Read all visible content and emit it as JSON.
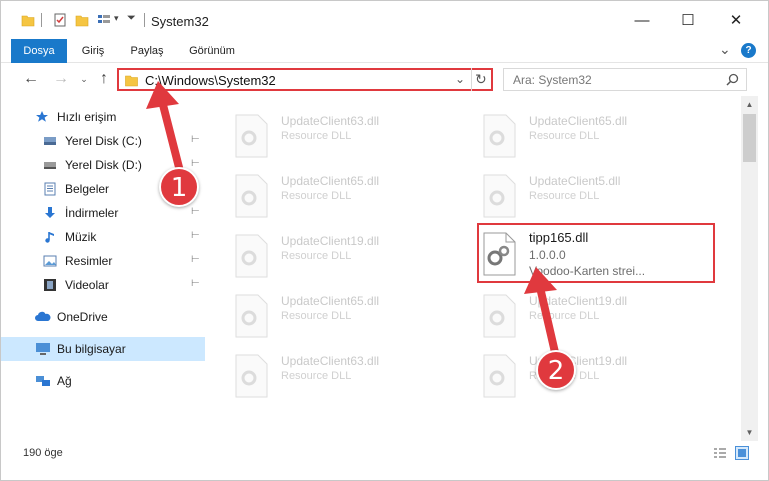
{
  "window": {
    "title": "System32",
    "minimize_glyph": "—",
    "maximize_glyph": "☐",
    "close_glyph": "✕"
  },
  "ribbon": {
    "tabs": [
      {
        "label": "Dosya",
        "active": true
      },
      {
        "label": "Giriş"
      },
      {
        "label": "Paylaş"
      },
      {
        "label": "Görünüm"
      }
    ],
    "collapse_glyph": "⌄",
    "help_glyph": "?"
  },
  "navbar": {
    "address": "C:\\Windows\\System32",
    "search_placeholder": "Ara: System32"
  },
  "sidebar": {
    "items": [
      {
        "label": "Hızlı erişim",
        "icon": "star-icon"
      },
      {
        "label": "Yerel Disk (C:)",
        "icon": "drive-icon",
        "pinned": true
      },
      {
        "label": "Yerel Disk (D:)",
        "icon": "drive-icon",
        "pinned": true
      },
      {
        "label": "Belgeler",
        "icon": "documents-icon"
      },
      {
        "label": "İndirmeler",
        "icon": "download-icon",
        "pinned": true
      },
      {
        "label": "Müzik",
        "icon": "music-icon",
        "pinned": true
      },
      {
        "label": "Resimler",
        "icon": "pictures-icon",
        "pinned": true
      },
      {
        "label": "Videolar",
        "icon": "videos-icon",
        "pinned": true
      },
      {
        "label": "OneDrive",
        "icon": "cloud-icon"
      },
      {
        "label": "Bu bilgisayar",
        "icon": "computer-icon",
        "selected": true
      },
      {
        "label": "Ağ",
        "icon": "network-icon"
      }
    ],
    "pin_glyph": "📌"
  },
  "files": [
    {
      "name": "UpdateClient63.dll",
      "desc": "Resource DLL"
    },
    {
      "name": "UpdateClient65.dll",
      "desc": "Resource DLL"
    },
    {
      "name": "UpdateClient65.dll",
      "desc": "Resource DLL"
    },
    {
      "name": "UpdateClient5.dll",
      "desc": "Resource DLL"
    },
    {
      "name": "UpdateClient19.dll",
      "desc": "Resource DLL"
    },
    {
      "name": "tipp165.dll",
      "version": "1.0.0.0",
      "desc": "Voodoo-Karten strei...",
      "highlighted": true
    },
    {
      "name": "UpdateClient65.dll",
      "desc": "Resource DLL"
    },
    {
      "name": "UpdateClient19.dll",
      "desc": "Resource DLL"
    },
    {
      "name": "UpdateClient63.dll",
      "desc": "Resource DLL"
    },
    {
      "name": "UpdateClient19.dll",
      "desc": "Resource DLL"
    }
  ],
  "status": {
    "count": "190 öge"
  },
  "annotations": {
    "step1": "1",
    "step2": "2",
    "color": "#e0393e"
  }
}
